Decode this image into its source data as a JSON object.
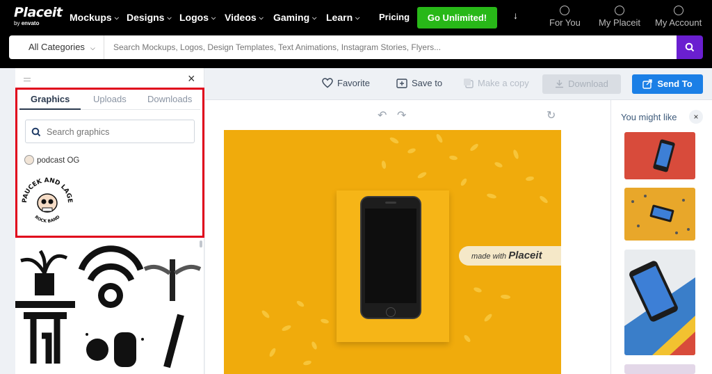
{
  "header": {
    "logo_text": "Placeit",
    "logo_sub_by": "by",
    "logo_sub_brand": "envato",
    "nav": [
      "Mockups",
      "Designs",
      "Logos",
      "Videos",
      "Gaming",
      "Learn"
    ],
    "pricing": "Pricing",
    "cta": "Go Unlimited!",
    "download_arrow": "↓",
    "for_you": "For You",
    "my_placeit": "My Placeit",
    "my_account": "My Account"
  },
  "search": {
    "category": "All Categories",
    "placeholder": "Search Mockups, Logos, Design Templates, Text Animations, Instagram Stories, Flyers..."
  },
  "toolbar": {
    "favorite": "Favorite",
    "save_to": "Save to",
    "make_copy": "Make a copy",
    "download": "Download",
    "send_to": "Send To"
  },
  "left_panel": {
    "tabs": [
      "Graphics",
      "Uploads",
      "Downloads"
    ],
    "active_tab": "Graphics",
    "search_placeholder": "Search graphics",
    "upload_name": "podcast OG",
    "badge_top": "PAUCEK AND LAGE",
    "badge_bottom": "ROCK BAND"
  },
  "canvas": {
    "watermark_prefix": "made with",
    "watermark_brand": "Placeit"
  },
  "right_panel": {
    "title": "You might like"
  },
  "colors": {
    "cta_green": "#28b818",
    "search_purple": "#6a1fd0",
    "send_blue": "#1b7fe6",
    "highlight_red": "#e0001b",
    "photo_yellow": "#f0ab0c"
  }
}
